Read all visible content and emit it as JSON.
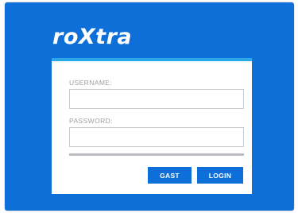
{
  "brand": {
    "logo_text": "roXtra"
  },
  "login_form": {
    "username_label": "USERNAME:",
    "username_value": "",
    "password_label": "PASSWORD:",
    "password_value": "",
    "guest_button_label": "GAST",
    "login_button_label": "LOGIN"
  },
  "colors": {
    "background": "#0e6fd8",
    "card_accent": "#29a9ea",
    "button": "#0e6fd8"
  }
}
